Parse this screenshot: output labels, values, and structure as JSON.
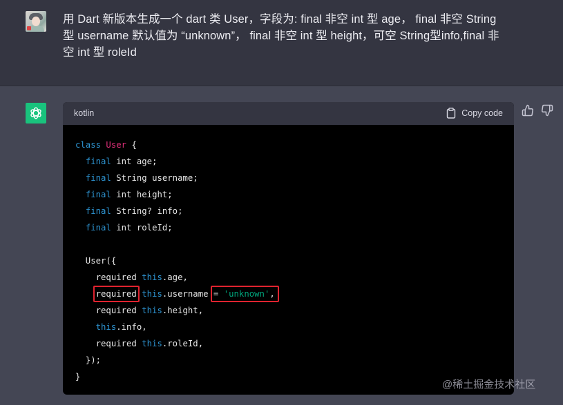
{
  "user_message": {
    "lines": [
      "用 Dart 新版本生成一个 dart 类 User，字段为: final 非空 int 型 age， final 非空 String",
      "型 username 默认值为 “unknown”， final 非空 int 型 height，可空 String型info,final 非",
      "空 int 型 roleId"
    ]
  },
  "code_block": {
    "language": "kotlin",
    "copy_label": "Copy code",
    "lines": [
      [
        {
          "t": "class ",
          "c": "kw"
        },
        {
          "t": "User",
          "c": "cls"
        },
        {
          "t": " {",
          "c": ""
        }
      ],
      [
        {
          "t": "  ",
          "c": ""
        },
        {
          "t": "final",
          "c": "kw"
        },
        {
          "t": " int age;",
          "c": ""
        }
      ],
      [
        {
          "t": "  ",
          "c": ""
        },
        {
          "t": "final",
          "c": "kw"
        },
        {
          "t": " String username;",
          "c": ""
        }
      ],
      [
        {
          "t": "  ",
          "c": ""
        },
        {
          "t": "final",
          "c": "kw"
        },
        {
          "t": " int height;",
          "c": ""
        }
      ],
      [
        {
          "t": "  ",
          "c": ""
        },
        {
          "t": "final",
          "c": "kw"
        },
        {
          "t": " String? info;",
          "c": ""
        }
      ],
      [
        {
          "t": "  ",
          "c": ""
        },
        {
          "t": "final",
          "c": "kw"
        },
        {
          "t": " int roleId;",
          "c": ""
        }
      ],
      [],
      [
        {
          "t": "  User({",
          "c": ""
        }
      ],
      [
        {
          "t": "    required ",
          "c": ""
        },
        {
          "t": "this",
          "c": "kw"
        },
        {
          "t": ".age,",
          "c": ""
        }
      ],
      [
        {
          "t": "    required ",
          "c": ""
        },
        {
          "t": "this",
          "c": "kw"
        },
        {
          "t": ".username = ",
          "c": ""
        },
        {
          "t": "'unknown'",
          "c": "str"
        },
        {
          "t": ",",
          "c": ""
        }
      ],
      [
        {
          "t": "    required ",
          "c": ""
        },
        {
          "t": "this",
          "c": "kw"
        },
        {
          "t": ".height,",
          "c": ""
        }
      ],
      [
        {
          "t": "    ",
          "c": ""
        },
        {
          "t": "this",
          "c": "kw"
        },
        {
          "t": ".info,",
          "c": ""
        }
      ],
      [
        {
          "t": "    required ",
          "c": ""
        },
        {
          "t": "this",
          "c": "kw"
        },
        {
          "t": ".roleId,",
          "c": ""
        }
      ],
      [
        {
          "t": "  });",
          "c": ""
        }
      ],
      [
        {
          "t": "}",
          "c": ""
        }
      ]
    ]
  },
  "icons": {
    "copy": "clipboard-icon",
    "like": "thumbs-up-icon",
    "dislike": "thumbs-down-icon",
    "assistant": "openai-logo-icon"
  },
  "colors": {
    "assistant_avatar": "#19c37d",
    "highlight_box": "#e0232f",
    "keyword": "#2e95d3",
    "class_name": "#df3079",
    "string": "#00a67d"
  },
  "watermark": "@稀土掘金技术社区"
}
